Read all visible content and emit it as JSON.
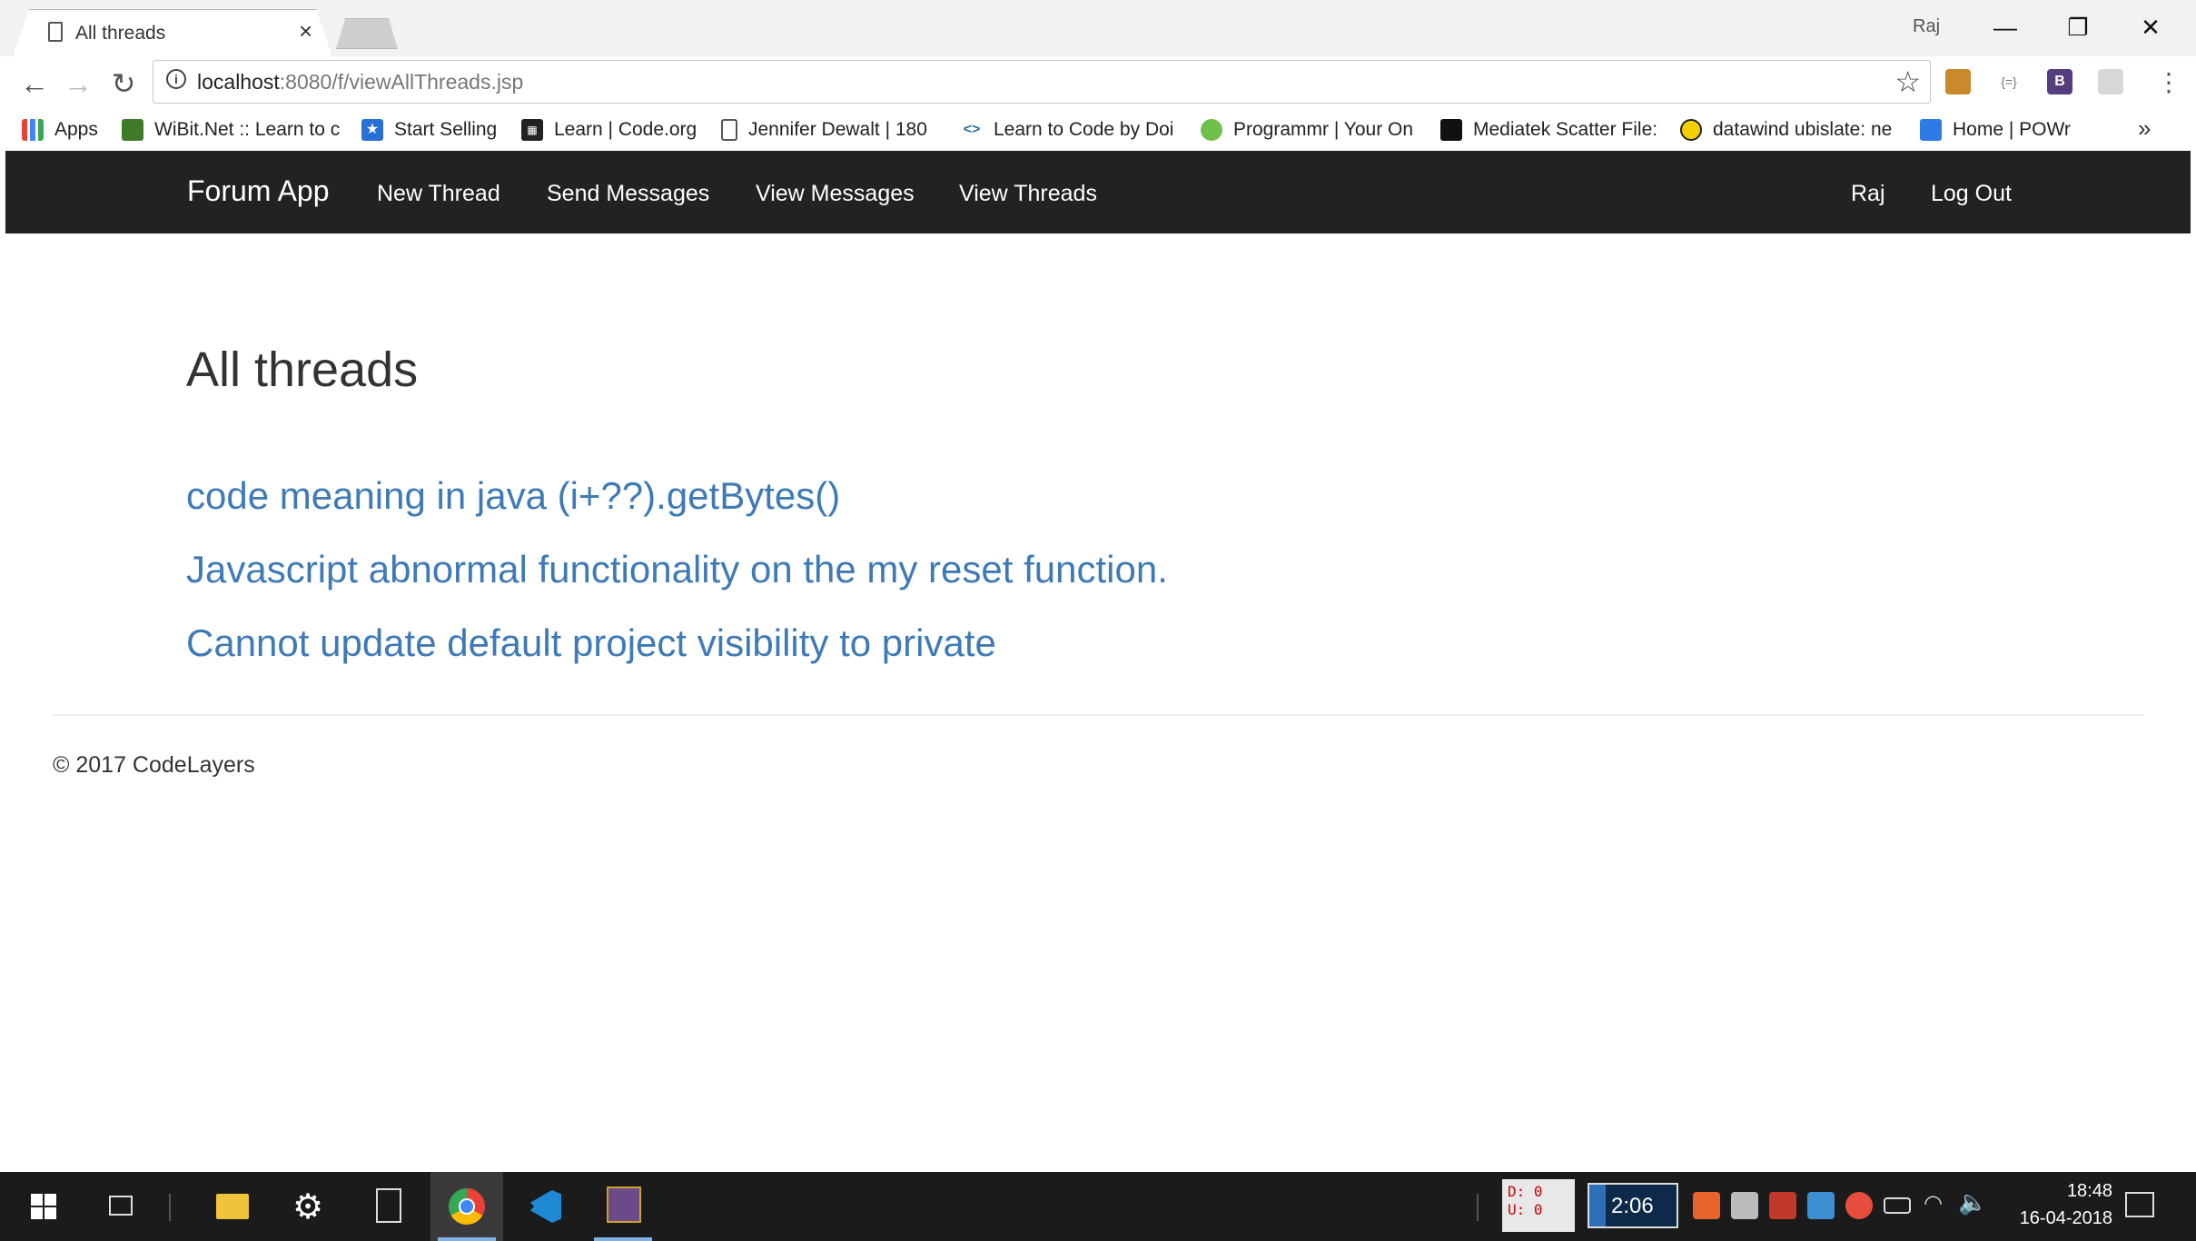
{
  "browser": {
    "tab_title": "All threads",
    "tab_close": "×",
    "window_user": "Raj",
    "window_controls": {
      "minimize": "—",
      "restore": "❐",
      "close": "✕"
    },
    "nav": {
      "back": "←",
      "forward": "→",
      "reload": "↻"
    },
    "url_host": "localhost",
    "url_rest": ":8080/f/viewAllThreads.jsp",
    "info_icon": "i",
    "star": "☆",
    "extensions": [
      "gadget-extension-icon",
      "json-extension-icon",
      "bootstrap-extension-icon",
      "cast-extension-icon"
    ],
    "menu": "⋮"
  },
  "bookmarks": {
    "items": [
      {
        "label": "Apps",
        "icon": "apps-grid-icon"
      },
      {
        "label": "WiBit.Net :: Learn to c",
        "icon": "wibit-icon"
      },
      {
        "label": "Start Selling",
        "icon": "start-selling-icon"
      },
      {
        "label": "Learn | Code.org",
        "icon": "code-org-icon"
      },
      {
        "label": "Jennifer Dewalt | 180",
        "icon": "page-icon"
      },
      {
        "label": "Learn to Code by Doi",
        "icon": "code-brackets-icon"
      },
      {
        "label": "Programmr | Your On",
        "icon": "programmr-icon"
      },
      {
        "label": "Mediatek Scatter File:",
        "icon": "mediatek-icon"
      },
      {
        "label": "datawind ubislate: ne",
        "icon": "smiley-icon"
      },
      {
        "label": "Home | POWr",
        "icon": "powr-icon"
      }
    ],
    "more": "»"
  },
  "navbar": {
    "brand": "Forum App",
    "links": [
      "New Thread",
      "Send Messages",
      "View Messages",
      "View Threads"
    ],
    "user": "Raj",
    "logout": "Log Out"
  },
  "main": {
    "heading": "All threads",
    "threads": [
      "code meaning in java (i+??).getBytes()",
      "Javascript abnormal functionality on the my reset function.",
      "Cannot update default project visibility to private"
    ]
  },
  "footer": {
    "text": "© 2017 CodeLayers"
  },
  "taskbar": {
    "net_down": "D: 0",
    "net_up": "U: 0",
    "battery_time": "2:06",
    "time": "18:48",
    "date": "16-04-2018"
  },
  "colors": {
    "navbar_bg": "#222222",
    "link": "#3f7ab6",
    "taskbar_bg": "#1b1b1b"
  }
}
